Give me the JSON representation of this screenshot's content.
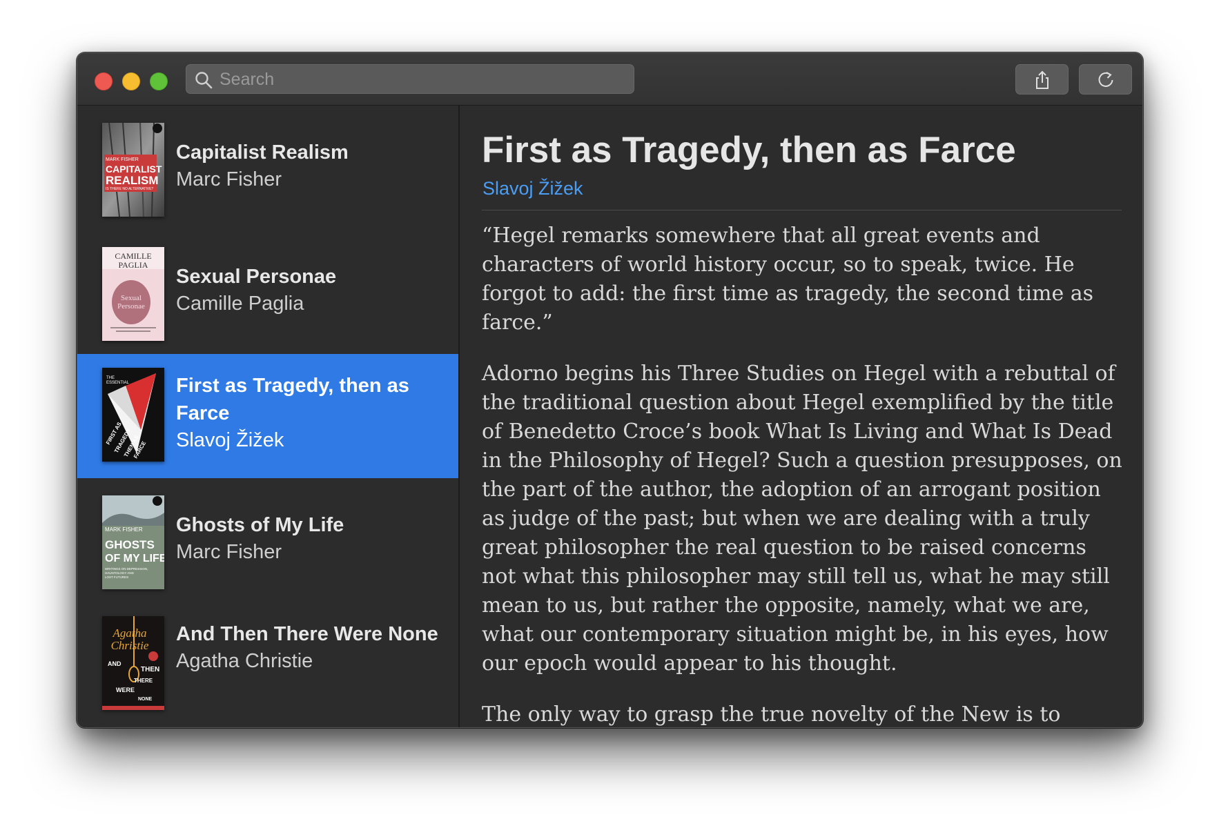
{
  "search": {
    "placeholder": "Search"
  },
  "toolbar": {
    "share_icon": "share-icon",
    "refresh_icon": "refresh-icon"
  },
  "books": [
    {
      "title": "Capitalist Realism",
      "author": "Marc Fisher",
      "cover": {
        "top_text": "MARK FISHER",
        "main_text": "CAPITALIST REALISM",
        "sub_text": "IS THERE NO ALTERNATIVE?"
      }
    },
    {
      "title": "Sexual Personae",
      "author": "Camille Paglia",
      "cover": {
        "top_text": "CAMILLE PAGLIA",
        "main_text": "Sexual Personae"
      }
    },
    {
      "title": "First as Tragedy, then as Farce",
      "author": "Slavoj Žižek",
      "selected": true,
      "cover": {
        "top_text": "THE ESSENTIAL ŽIŽEK",
        "main_text": "FIRST AS TRAGEDY THEN AS FARCE"
      }
    },
    {
      "title": "Ghosts of My Life",
      "author": "Marc Fisher",
      "cover": {
        "top_text": "MARK FISHER",
        "main_text": "GHOSTS OF MY LIFE",
        "sub_text": "WRITINGS ON DEPRESSION, HAUNTOLOGY AND LOST FUTURES"
      }
    },
    {
      "title": "And Then There Were None",
      "author": "Agatha Christie",
      "cover": {
        "top_text": "Agatha Christie",
        "main_text": "AND THEN THERE WERE NONE"
      }
    }
  ],
  "detail": {
    "title": "First as Tragedy, then as Farce",
    "author": "Slavoj Žižek",
    "paragraphs": [
      "“Hegel remarks somewhere that all great events and characters of world history occur, so to speak, twice. He forgot to add: the first time as tragedy, the second time as farce.”",
      "Adorno begins his Three Studies on Hegel with a rebuttal of the traditional question about Hegel exemplified by the title of Benedetto Croce’s book What Is Living and What Is Dead in the Philosophy of Hegel? Such a question presupposes, on the part of the author, the adoption of an arrogant position as judge of the past; but when we are dealing with a truly great philosopher the real question to be raised concerns not what this philosopher may still tell us, what he may still mean to us, but rather the opposite, namely, what we are, what our contemporary situation might be, in his eyes, how our epoch would appear to his thought.",
      "The only way to grasp the true novelty of the New is to analyze the world through the lenses of what was “eternal” in"
    ]
  },
  "colors": {
    "selection": "#2f7ae5",
    "author_link": "#4a9ef5",
    "window_bg": "#2c2c2c"
  }
}
